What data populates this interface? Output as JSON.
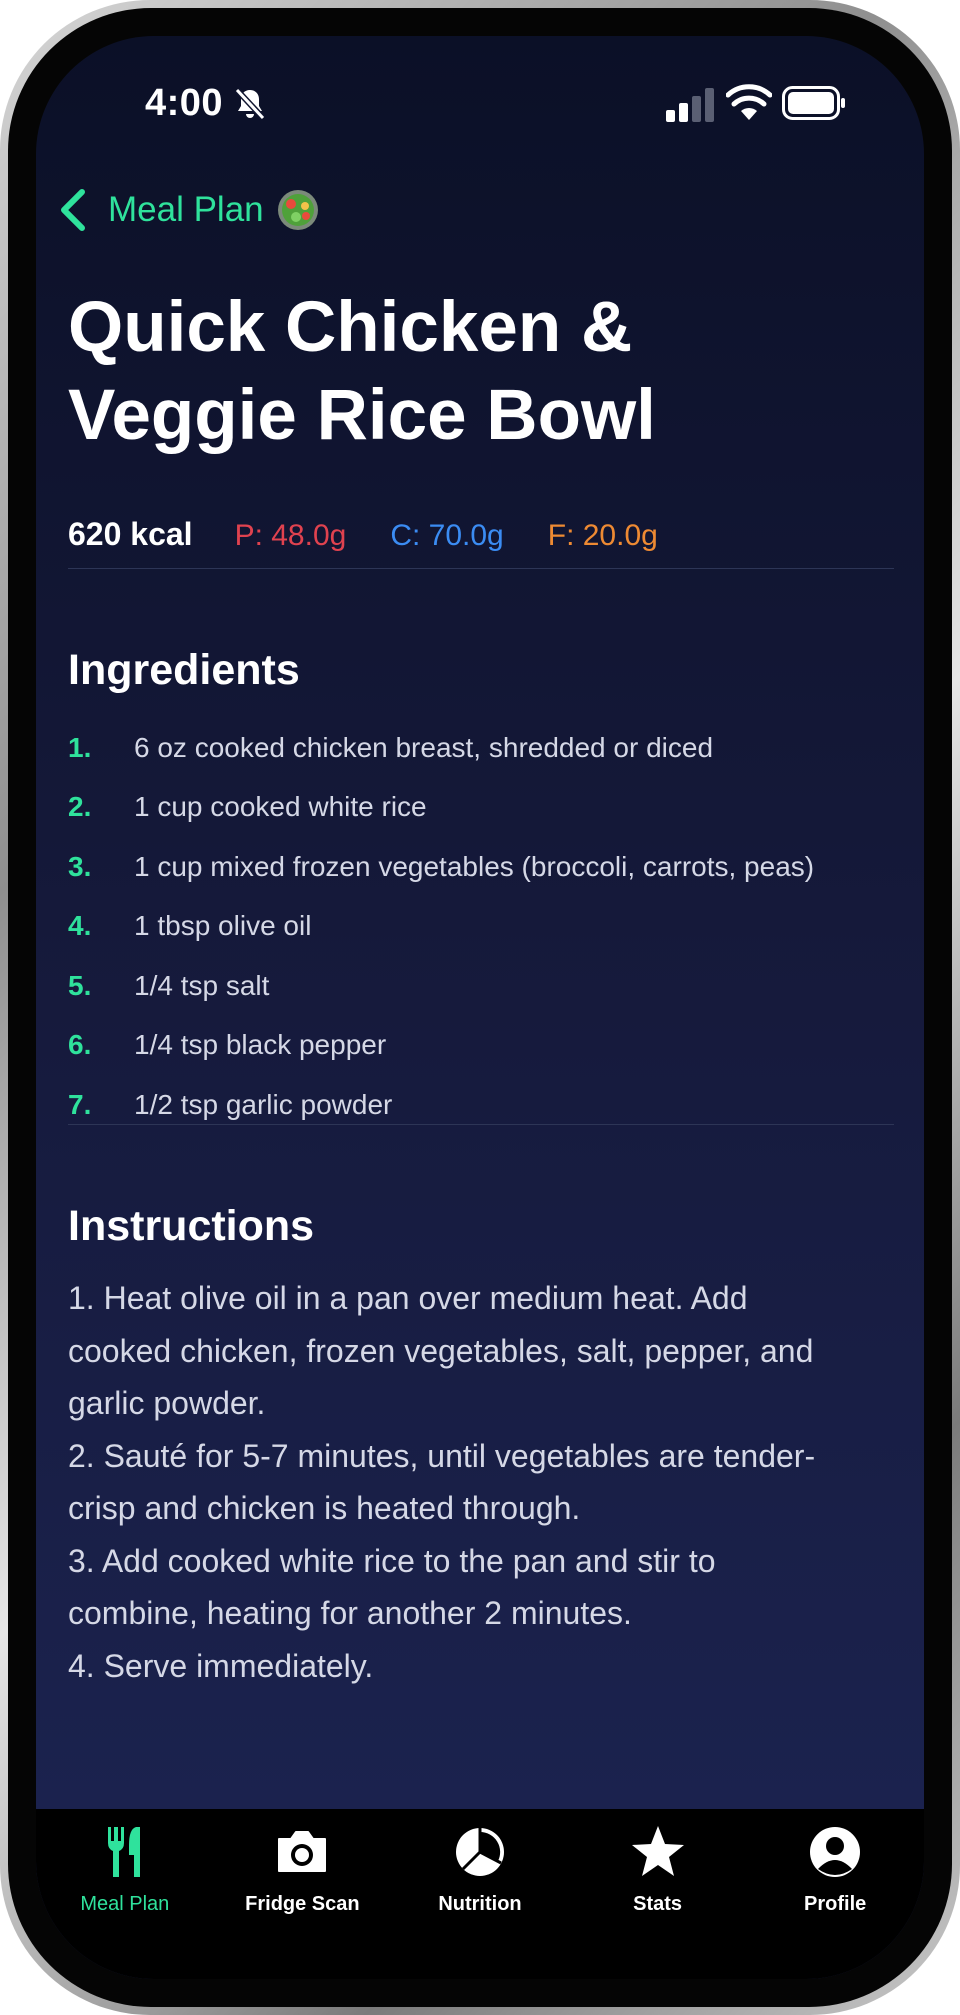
{
  "status_bar": {
    "time": "4:00"
  },
  "nav": {
    "back_label": "Meal Plan"
  },
  "recipe": {
    "title": "Quick Chicken & Veggie Rice Bowl",
    "kcal": "620 kcal",
    "protein": "P: 48.0g",
    "carbs": "C: 70.0g",
    "fat": "F: 20.0g"
  },
  "ingredients": {
    "heading": "Ingredients",
    "items": [
      {
        "num": "1.",
        "text": "6 oz cooked chicken breast, shredded or diced"
      },
      {
        "num": "2.",
        "text": "1 cup cooked white rice"
      },
      {
        "num": "3.",
        "text": "1 cup mixed frozen vegetables (broccoli, carrots, peas)"
      },
      {
        "num": "4.",
        "text": "1 tbsp olive oil"
      },
      {
        "num": "5.",
        "text": "1/4 tsp salt"
      },
      {
        "num": "6.",
        "text": "1/4 tsp black pepper"
      },
      {
        "num": "7.",
        "text": "1/2 tsp garlic powder"
      }
    ]
  },
  "instructions": {
    "heading": "Instructions",
    "lines": [
      "1. Heat olive oil in a pan over medium heat. Add",
      "cooked chicken, frozen vegetables, salt, pepper, and",
      "garlic powder.",
      "2. Sauté for 5-7 minutes, until vegetables are tender-",
      "crisp and chicken is heated through.",
      "3. Add cooked white rice to the pan and stir to",
      "combine, heating for another 2 minutes.",
      "4. Serve immediately."
    ]
  },
  "tabs": [
    {
      "label": "Meal Plan",
      "icon": "fork-knife-icon",
      "active": true
    },
    {
      "label": "Fridge Scan",
      "icon": "camera-icon",
      "active": false
    },
    {
      "label": "Nutrition",
      "icon": "pie-chart-icon",
      "active": false
    },
    {
      "label": "Stats",
      "icon": "star-icon",
      "active": false
    },
    {
      "label": "Profile",
      "icon": "person-icon",
      "active": false
    }
  ],
  "colors": {
    "accent": "#2fe29c",
    "protein": "#e0424f",
    "carbs": "#3b8cf3",
    "fat": "#ee8a33"
  }
}
